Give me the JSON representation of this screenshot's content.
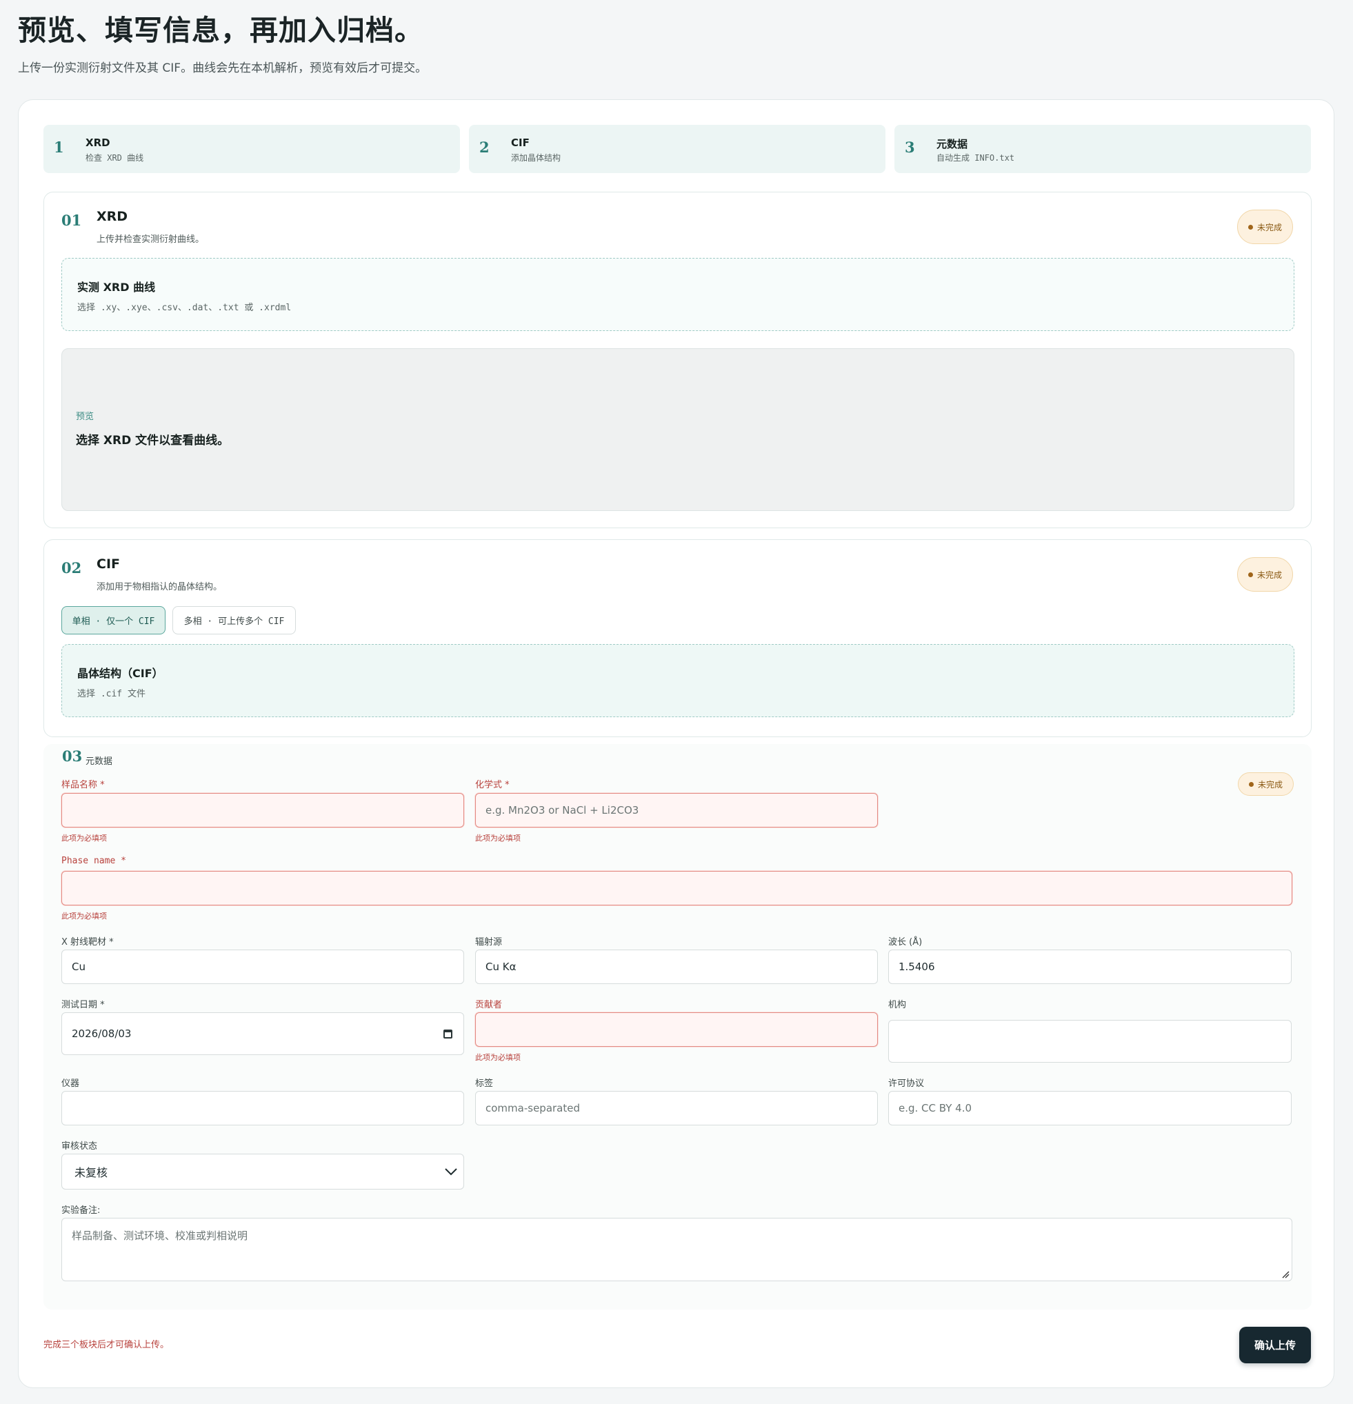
{
  "header": {
    "title": "预览、填写信息，再加入归档。",
    "subtitle": "上传一份实测衍射文件及其 CIF。曲线会先在本机解析，预览有效后才可提交。"
  },
  "steps": [
    {
      "num": "1",
      "title": "XRD",
      "desc": "检查 XRD 曲线"
    },
    {
      "num": "2",
      "title": "CIF",
      "desc": "添加晶体结构"
    },
    {
      "num": "3",
      "title": "元数据",
      "desc": "自动生成 INFO.txt"
    }
  ],
  "xrd": {
    "num": "01",
    "title": "XRD",
    "desc": "上传并检查实测衍射曲线。",
    "badge": "未完成",
    "upload_title": "实测 XRD 曲线",
    "upload_hint": "选择 .xy、.xye、.csv、.dat、.txt 或 .xrdml",
    "preview_label": "预览",
    "preview_text": "选择 XRD 文件以查看曲线。"
  },
  "cif": {
    "num": "02",
    "title": "CIF",
    "desc": "添加用于物相指认的晶体结构。",
    "badge": "未完成",
    "mode_single": "单相 · 仅一个 CIF",
    "mode_multi": "多相 · 可上传多个 CIF",
    "upload_title": "晶体结构（CIF）",
    "upload_hint": "选择 .cif 文件"
  },
  "meta": {
    "num": "03",
    "title": "元数据",
    "badge": "未完成",
    "required_error": "此项为必填项",
    "sample_name": {
      "label": "样品名称 *",
      "value": ""
    },
    "formula": {
      "label": "化学式 *",
      "placeholder": "e.g. Mn2O3 or NaCl + Li2CO3"
    },
    "phase_name": {
      "label": "Phase name *",
      "value": ""
    },
    "target": {
      "label": "X 射线靶材 *",
      "value": "Cu"
    },
    "source": {
      "label": "辐射源",
      "value": "Cu Kα"
    },
    "wavelength": {
      "label": "波长 (Å)",
      "value": "1.5406"
    },
    "date": {
      "label": "测试日期 *",
      "value": "2026/08/03"
    },
    "contributor": {
      "label": "贡献者",
      "value": ""
    },
    "institution": {
      "label": "机构",
      "value": ""
    },
    "instrument": {
      "label": "仪器",
      "value": ""
    },
    "tags": {
      "label": "标签",
      "placeholder": "comma-separated"
    },
    "license": {
      "label": "许可协议",
      "placeholder": "e.g. CC BY 4.0"
    },
    "review": {
      "label": "审核状态",
      "value": "未复核"
    },
    "notes": {
      "label": "实验备注:",
      "placeholder": "样品制备、测试环境、校准或判相说明"
    }
  },
  "footer": {
    "note": "完成三个板块后才可确认上传。",
    "submit": "确认上传"
  },
  "colors": {
    "accent": "#2b7d76",
    "error": "#b8423d",
    "badge_bg": "#fdf1df",
    "submit_bg": "#172830"
  }
}
